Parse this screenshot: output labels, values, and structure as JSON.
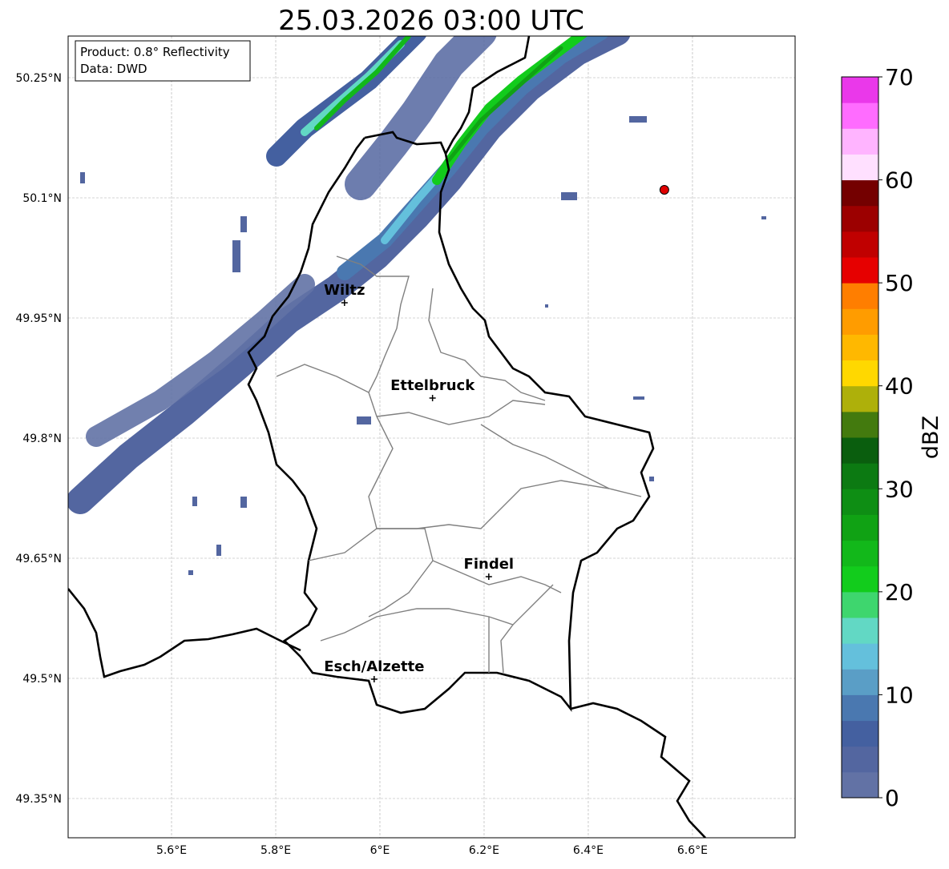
{
  "title": "25.03.2026 03:00 UTC",
  "info_box": {
    "line1": "Product: 0.8° Reflectivity",
    "line2": "Data: DWD"
  },
  "map": {
    "extent": {
      "lon_min": 5.4015,
      "lon_max": 6.797,
      "lat_min": 49.301,
      "lat_max": 50.302
    },
    "lon_ticks": [
      {
        "value": 5.6,
        "label": "5.6°E"
      },
      {
        "value": 5.8,
        "label": "5.8°E"
      },
      {
        "value": 6.0,
        "label": "6°E"
      },
      {
        "value": 6.2,
        "label": "6.2°E"
      },
      {
        "value": 6.4,
        "label": "6.4°E"
      },
      {
        "value": 6.6,
        "label": "6.6°E"
      }
    ],
    "lat_ticks": [
      {
        "value": 50.25,
        "label": "50.25°N"
      },
      {
        "value": 50.1,
        "label": "50.1°N"
      },
      {
        "value": 49.95,
        "label": "49.95°N"
      },
      {
        "value": 49.8,
        "label": "49.8°N"
      },
      {
        "value": 49.65,
        "label": "49.65°N"
      },
      {
        "value": 49.5,
        "label": "49.5°N"
      },
      {
        "value": 49.35,
        "label": "49.35°N"
      }
    ],
    "cities": [
      {
        "name": "Wiltz",
        "lon": 5.932,
        "lat": 49.969
      },
      {
        "name": "Ettelbruck",
        "lon": 6.101,
        "lat": 49.85
      },
      {
        "name": "Findel",
        "lon": 6.209,
        "lat": 49.627
      },
      {
        "name": "Esch/Alzette",
        "lon": 5.989,
        "lat": 49.499
      }
    ],
    "radar_site": {
      "lon": 6.546,
      "lat": 50.11,
      "color": "#e00000"
    }
  },
  "colorbar": {
    "label": "dBZ",
    "min": 0,
    "max": 70,
    "step": 2.5,
    "ticks": [
      {
        "value": 0,
        "label": "0"
      },
      {
        "value": 10,
        "label": "10"
      },
      {
        "value": 20,
        "label": "20"
      },
      {
        "value": 30,
        "label": "30"
      },
      {
        "value": 40,
        "label": "40"
      },
      {
        "value": 50,
        "label": "50"
      },
      {
        "value": 60,
        "label": "60"
      },
      {
        "value": 70,
        "label": "70"
      }
    ],
    "colors": [
      "#6272a5",
      "#5366a0",
      "#4460a0",
      "#4a78b0",
      "#5a9ec6",
      "#64c0dc",
      "#62d8c4",
      "#3ed66e",
      "#12cc1c",
      "#12b81a",
      "#10a214",
      "#0e8e14",
      "#0c7a12",
      "#0a5e0e",
      "#437a0e",
      "#aeb00a",
      "#ffd800",
      "#ffb800",
      "#ff9c00",
      "#ff7e00",
      "#e60000",
      "#c00000",
      "#9c0000",
      "#740000",
      "#ffe0ff",
      "#ffb4ff",
      "#ff6cff",
      "#ea38ea"
    ]
  }
}
